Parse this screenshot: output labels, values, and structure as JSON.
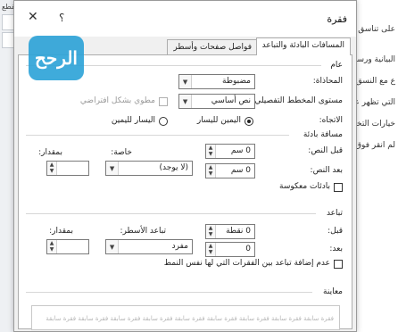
{
  "background": {
    "ribbon_label": "القطع",
    "right_lines": [
      "على تناسق لذ",
      "البيانية ورسوم",
      "ع مع النسق الج",
      "التي تظهر عند",
      "خيارات التخطي",
      "لم انقر فوق"
    ]
  },
  "dialog": {
    "title": "فقرة",
    "help": "؟",
    "close": "✕",
    "tabs": [
      {
        "label": "المسافات البادئة والتباعد"
      },
      {
        "label": "فواصل صفحات وأسطر"
      }
    ],
    "general": {
      "heading": "عام",
      "alignment_label": "المحاذاة:",
      "alignment_value": "مضبوطة",
      "outline_label": "مستوى المخطط التفصيلي:",
      "outline_value": "نص أساسي",
      "collapsed_label": "مطوي بشكل افتراضي",
      "direction_label": "الاتجاه:",
      "rtl_label": "اليمين لليسار",
      "ltr_label": "اليسار لليمين"
    },
    "indentation": {
      "heading": "مسافة بادئة",
      "before_label": "قبل النص:",
      "before_value": "0 سم",
      "after_label": "بعد النص:",
      "after_value": "0 سم",
      "special_label": "خاصة:",
      "special_value": "(لا يوجد)",
      "by_label": "بمقدار:",
      "by_value": "",
      "mirror_label": "بادئات معكوسة"
    },
    "spacing": {
      "heading": "تباعد",
      "before_label": "قبل:",
      "before_value": "0 نقطة",
      "after_label": "بعد:",
      "after_value": "0",
      "line_label": "تباعد الأسطر:",
      "line_value": "مفرد",
      "at_label": "بمقدار:",
      "at_value": "",
      "no_space_label": "عدم إضافة تباعد بين الفقرات التي لها نفس النمط"
    },
    "preview": {
      "heading": "معاينة",
      "text": "فقرة سابقة فقرة سابقة فقرة سابقة فقرة سابقة فقرة سابقة فقرة سابقة فقرة سابقة فقرة سابقة فقرة سابقة"
    }
  },
  "logo": {
    "text": "الرحح"
  }
}
